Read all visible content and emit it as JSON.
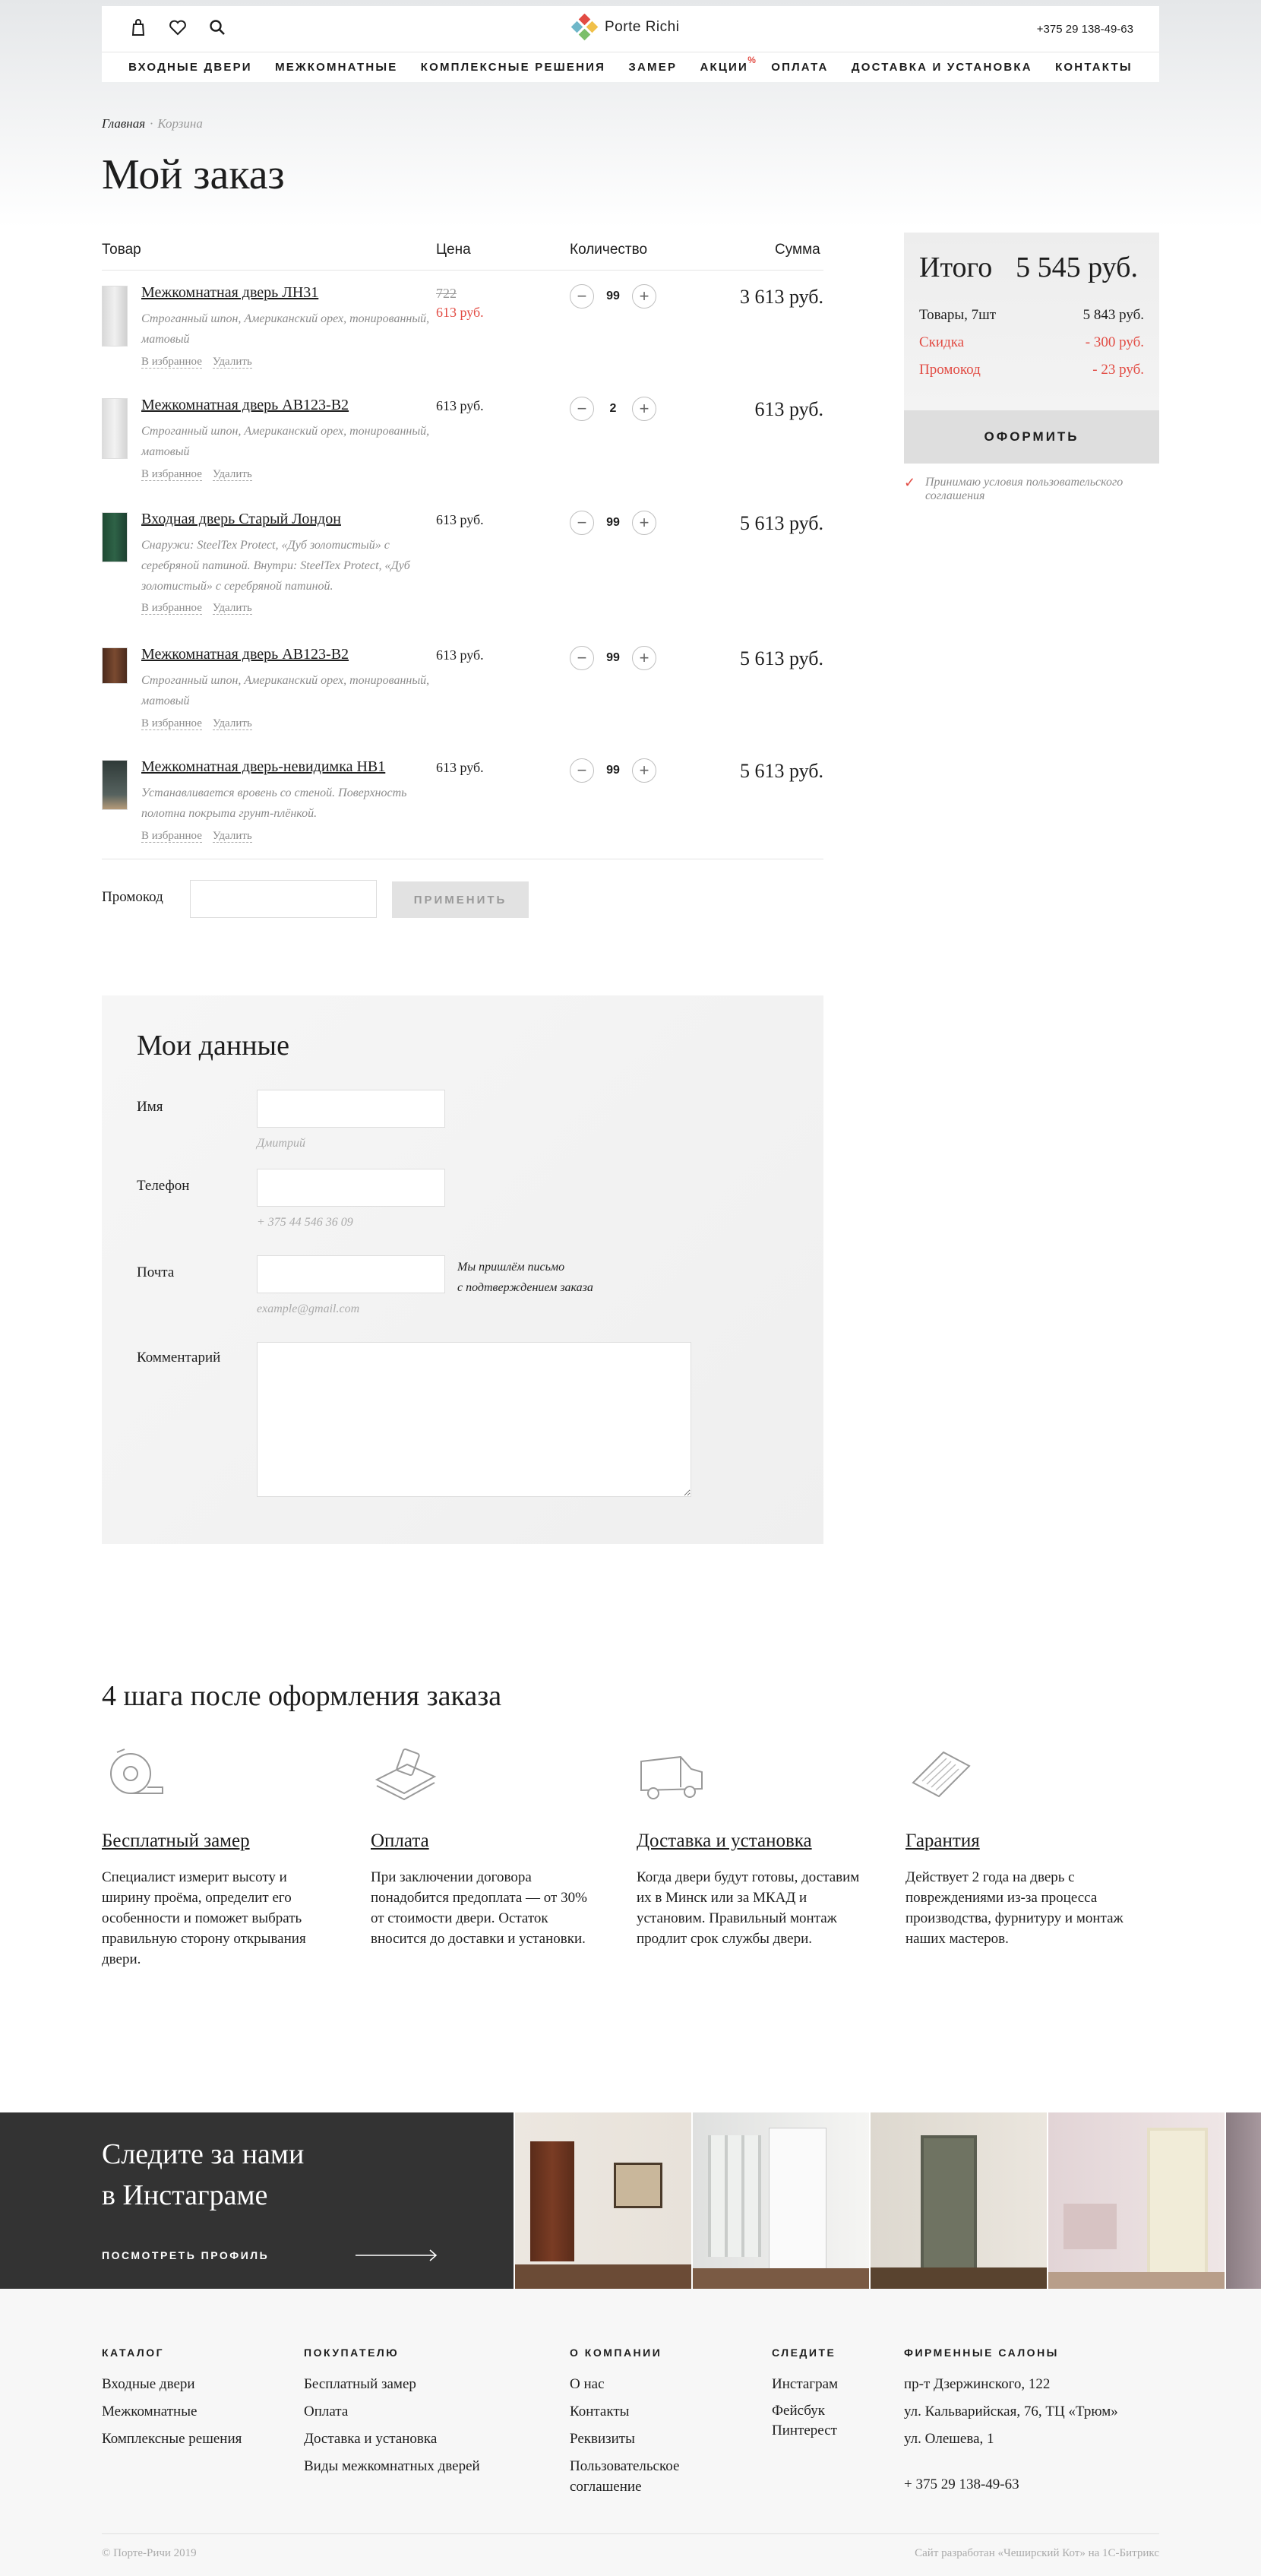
{
  "header": {
    "logo": "Porte Richi",
    "phone": "+375 29 138-49-63",
    "nav": [
      {
        "label": "ВХОДНЫЕ ДВЕРИ"
      },
      {
        "label": "МЕЖКОМНАТНЫЕ"
      },
      {
        "label": "КОМПЛЕКСНЫЕ РЕШЕНИЯ"
      },
      {
        "label": "ЗАМЕР"
      },
      {
        "label": "АКЦИИ",
        "badge": "%"
      },
      {
        "label": "ОПЛАТА"
      },
      {
        "label": "ДОСТАВКА И УСТАНОВКА"
      },
      {
        "label": "КОНТАКТЫ"
      }
    ],
    "icons": [
      "cart-icon",
      "heart-icon",
      "search-icon"
    ]
  },
  "breadcrumb": {
    "home": "Главная",
    "sep": "·",
    "current": "Корзина"
  },
  "page_title": "Мой заказ",
  "table": {
    "headers": {
      "product": "Товар",
      "price": "Цена",
      "qty": "Количество",
      "sum": "Сумма"
    },
    "favorite_label": "В избранное",
    "remove_label": "Удалить",
    "items": [
      {
        "name": "Межкомнатная дверь ЛН31",
        "desc": "Строганный шпон, Американский орех, тонированный, матовый",
        "old_price": "722",
        "price": "613 руб.",
        "qty": "99",
        "sum": "3 613 руб."
      },
      {
        "name": "Межкомнатная дверь АВ123-В2",
        "desc": "Строганный шпон, Американский орех, тонированный, матовый",
        "price": "613 руб.",
        "qty": "2",
        "sum": "613 руб."
      },
      {
        "name": "Входная дверь Старый Лондон",
        "desc": "Снаружи: SteelTex Protect, «Дуб золотистый» с серебряной патиной. Внутри: SteelTex Protect, «Дуб золотистый» с серебряной патиной.",
        "price": "613 руб.",
        "qty": "99",
        "sum": "5 613 руб."
      },
      {
        "name": "Межкомнатная дверь АВ123-В2",
        "desc": "Строганный шпон, Американский орех, тонированный, матовый",
        "price": "613 руб.",
        "qty": "99",
        "sum": "5 613 руб."
      },
      {
        "name": "Межкомнатная дверь-невидимка НВ1",
        "desc": "Устанавливается вровень со стеной. Поверхность полотна покрыта грунт-плёнкой.",
        "price": "613 руб.",
        "qty": "99",
        "sum": "5 613 руб."
      }
    ]
  },
  "promo": {
    "label": "Промокод",
    "button": "ПРИМЕНИТЬ"
  },
  "summary": {
    "title": "Итого",
    "total": "5 545 руб.",
    "goods_label": "Товары, 7шт",
    "goods_value": "5 843 руб.",
    "discount_label": "Скидка",
    "discount_value": "- 300 руб.",
    "promo_label": "Промокод",
    "promo_value": "- 23 руб.",
    "checkout": "ОФОРМИТЬ",
    "agree": "Принимаю условия пользовательского соглашения"
  },
  "form": {
    "title": "Мои данные",
    "name_label": "Имя",
    "name_hint": "Дмитрий",
    "phone_label": "Телефон",
    "phone_hint": "+ 375 44 546 36 09",
    "email_label": "Почта",
    "email_hint": "example@gmail.com",
    "email_note_1": "Мы пришлём письмо",
    "email_note_2": "с подтверждением заказа",
    "comment_label": "Комментарий"
  },
  "steps": {
    "title": "4 шага после оформления заказа",
    "items": [
      {
        "title": "Бесплатный замер",
        "text": "Специалист измерит высоту и ширину проёма, определит его особенности и поможет выбрать правильную сторону открывания двери."
      },
      {
        "title": "Оплата",
        "text": "При заключении договора понадобится предоплата — от 30% от стоимости двери. Остаток вносится до доставки и установки."
      },
      {
        "title": "Доставка и установка",
        "text": "Когда двери будут готовы, доставим их в Минск или за МКАД и установим. Правильный монтаж продлит срок службы двери."
      },
      {
        "title": "Гарантия",
        "text": "Действует 2 года на дверь с повреждениями из-за процесса производства, фурнитуру и монтаж наших мастеров."
      }
    ]
  },
  "instagram": {
    "title_1": "Следите за нами",
    "title_2": "в Инстаграме",
    "link": "ПОСМОТРЕТЬ ПРОФИЛЬ"
  },
  "footer": {
    "cols": [
      {
        "title": "КАТАЛОГ",
        "items": [
          "Входные двери",
          "Межкомнатные",
          "Комплексные решения"
        ]
      },
      {
        "title": "ПОКУПАТЕЛЮ",
        "items": [
          "Бесплатный замер",
          "Оплата",
          "Доставка и установка",
          "Виды межкомнатных дверей"
        ]
      },
      {
        "title": "О КОМПАНИИ",
        "items": [
          "О нас",
          "Контакты",
          "Реквизиты",
          "Пользовательское соглашение"
        ]
      },
      {
        "title": "СЛЕДИТЕ",
        "items": [
          "Инстаграм",
          "Фейсбук",
          "Пинтерест"
        ]
      },
      {
        "title": "ФИРМЕННЫЕ САЛОНЫ",
        "items": [
          "пр-т Дзержинского, 122",
          "ул. Кальварийская, 76, ТЦ «Трюм»",
          "ул. Олешева, 1"
        ],
        "phone": "+ 375 29 138-49-63"
      }
    ],
    "copyright": "© Порте-Ричи 2019",
    "developer": "Сайт разработан «Чеширский Кот» на 1С-Битрикс"
  },
  "colors": {
    "accent": "#e24b43",
    "dark": "#333333",
    "text": "#1d1d1d",
    "muted": "#8b8b8b"
  }
}
